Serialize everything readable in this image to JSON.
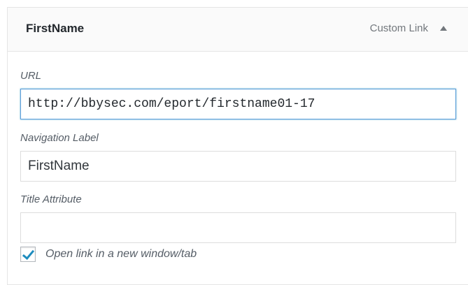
{
  "menu_item": {
    "title": "FirstName",
    "item_type": "Custom Link",
    "toggle_icon": "arrow-up-icon"
  },
  "fields": {
    "url": {
      "label": "URL",
      "value": "http://bbysec.com/eport/firstname01-17"
    },
    "navigation_label": {
      "label": "Navigation Label",
      "value": "FirstName"
    },
    "title_attribute": {
      "label": "Title Attribute",
      "value": ""
    },
    "open_new_window": {
      "label": "Open link in a new window/tab",
      "checked": true
    }
  },
  "colors": {
    "focus_border": "#5b9dd9",
    "checkmark": "#1e8cbe",
    "header_bg": "#fafafa"
  }
}
